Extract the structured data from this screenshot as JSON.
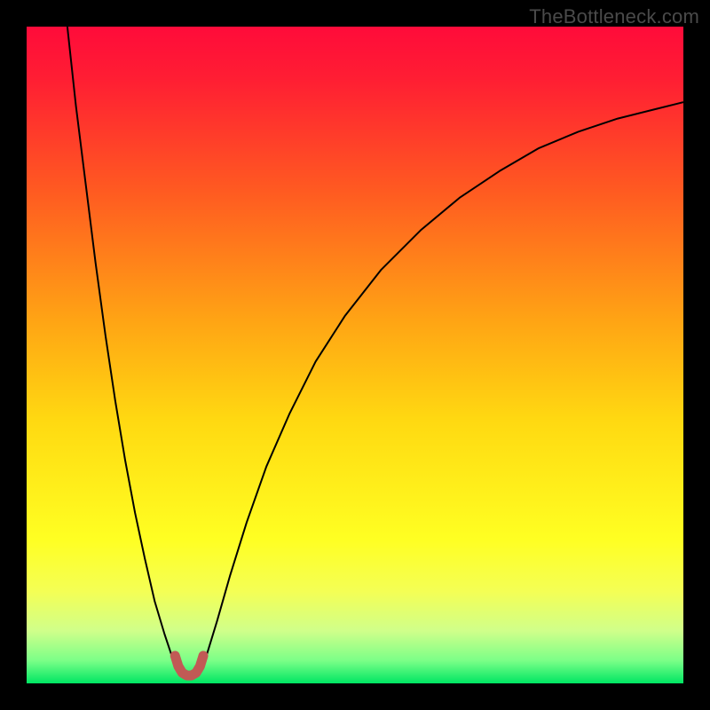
{
  "watermark": "TheBottleneck.com",
  "chart_data": {
    "type": "line",
    "title": "",
    "xlabel": "",
    "ylabel": "",
    "xlim": [
      0,
      100
    ],
    "ylim": [
      0,
      100
    ],
    "gradient_stops": [
      {
        "offset": 0,
        "color": "#ff0b3a"
      },
      {
        "offset": 0.08,
        "color": "#ff1e33"
      },
      {
        "offset": 0.25,
        "color": "#ff5a21"
      },
      {
        "offset": 0.45,
        "color": "#ffa514"
      },
      {
        "offset": 0.6,
        "color": "#ffd911"
      },
      {
        "offset": 0.78,
        "color": "#ffff22"
      },
      {
        "offset": 0.86,
        "color": "#f4ff55"
      },
      {
        "offset": 0.92,
        "color": "#d0ff8a"
      },
      {
        "offset": 0.965,
        "color": "#7cff88"
      },
      {
        "offset": 1.0,
        "color": "#00e663"
      }
    ],
    "series": [
      {
        "name": "bottleneck-curve",
        "color": "#000000",
        "stroke_width": 2,
        "points": [
          {
            "x": 6.2,
            "y": 100.0
          },
          {
            "x": 7.5,
            "y": 88.0
          },
          {
            "x": 9.0,
            "y": 76.0
          },
          {
            "x": 10.5,
            "y": 64.0
          },
          {
            "x": 12.0,
            "y": 53.0
          },
          {
            "x": 13.5,
            "y": 43.0
          },
          {
            "x": 15.0,
            "y": 34.0
          },
          {
            "x": 16.5,
            "y": 26.0
          },
          {
            "x": 18.0,
            "y": 19.0
          },
          {
            "x": 19.5,
            "y": 12.5
          },
          {
            "x": 21.0,
            "y": 7.5
          },
          {
            "x": 22.0,
            "y": 4.5
          },
          {
            "x": 22.8,
            "y": 2.5
          },
          {
            "x": 23.5,
            "y": 1.4
          },
          {
            "x": 24.3,
            "y": 0.9
          },
          {
            "x": 25.2,
            "y": 0.9
          },
          {
            "x": 26.0,
            "y": 1.4
          },
          {
            "x": 26.8,
            "y": 2.6
          },
          {
            "x": 27.5,
            "y": 4.6
          },
          {
            "x": 29.0,
            "y": 9.5
          },
          {
            "x": 31.0,
            "y": 16.5
          },
          {
            "x": 33.5,
            "y": 24.5
          },
          {
            "x": 36.5,
            "y": 33.0
          },
          {
            "x": 40.0,
            "y": 41.0
          },
          {
            "x": 44.0,
            "y": 49.0
          },
          {
            "x": 48.5,
            "y": 56.0
          },
          {
            "x": 54.0,
            "y": 63.0
          },
          {
            "x": 60.0,
            "y": 69.0
          },
          {
            "x": 66.0,
            "y": 74.0
          },
          {
            "x": 72.0,
            "y": 78.0
          },
          {
            "x": 78.0,
            "y": 81.5
          },
          {
            "x": 84.0,
            "y": 84.0
          },
          {
            "x": 90.0,
            "y": 86.0
          },
          {
            "x": 96.0,
            "y": 87.5
          },
          {
            "x": 100.0,
            "y": 88.5
          }
        ]
      },
      {
        "name": "dip-marker",
        "color": "#c15a55",
        "stroke_width": 11,
        "linecap": "round",
        "points": [
          {
            "x": 22.6,
            "y": 4.2
          },
          {
            "x": 23.1,
            "y": 2.6
          },
          {
            "x": 23.7,
            "y": 1.6
          },
          {
            "x": 24.4,
            "y": 1.2
          },
          {
            "x": 25.1,
            "y": 1.2
          },
          {
            "x": 25.8,
            "y": 1.6
          },
          {
            "x": 26.4,
            "y": 2.6
          },
          {
            "x": 26.9,
            "y": 4.2
          }
        ]
      }
    ]
  }
}
